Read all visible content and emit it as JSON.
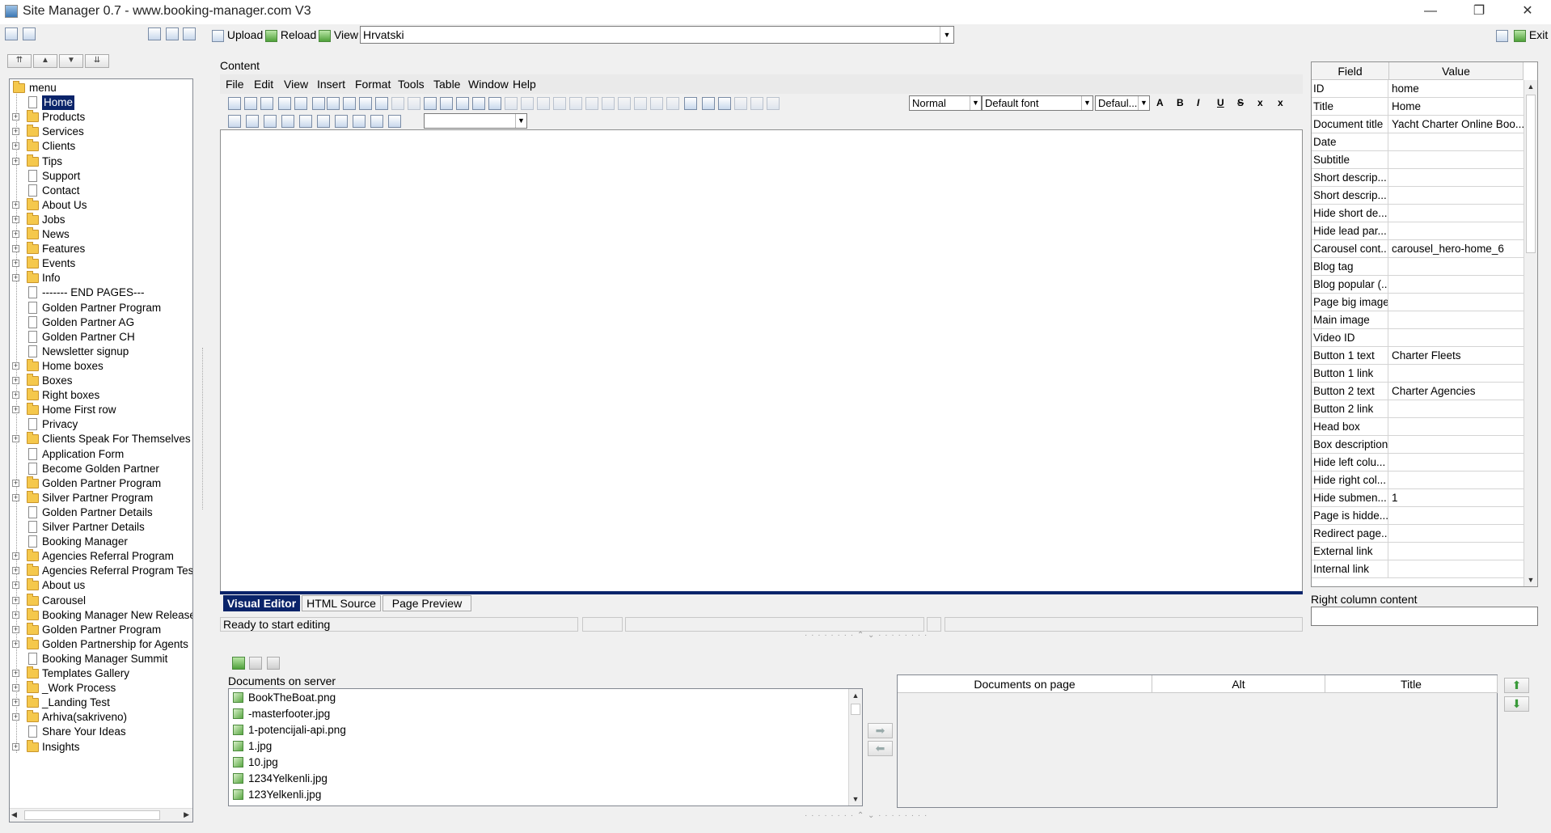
{
  "window": {
    "title": "Site Manager 0.7 - www.booking-manager.com V3",
    "controls": [
      "—",
      "❐",
      "✕"
    ]
  },
  "toolbar": {
    "upload_label": "Upload",
    "reload_label": "Reload",
    "view_label": "View",
    "view_value": "Hrvatski",
    "exit_label": "Exit"
  },
  "tree": {
    "root": "menu",
    "items": [
      {
        "label": "Home",
        "type": "page",
        "expand": false,
        "selected": true
      },
      {
        "label": "Products",
        "type": "folder",
        "expand": true
      },
      {
        "label": "Services",
        "type": "folder",
        "expand": true
      },
      {
        "label": "Clients",
        "type": "folder",
        "expand": true
      },
      {
        "label": "Tips",
        "type": "folder",
        "expand": true
      },
      {
        "label": "Support",
        "type": "page",
        "expand": false
      },
      {
        "label": "Contact",
        "type": "page",
        "expand": false
      },
      {
        "label": "About Us",
        "type": "folder",
        "expand": true
      },
      {
        "label": "Jobs",
        "type": "folder",
        "expand": true
      },
      {
        "label": "News",
        "type": "folder",
        "expand": true
      },
      {
        "label": "Features",
        "type": "folder",
        "expand": true
      },
      {
        "label": "Events",
        "type": "folder",
        "expand": true
      },
      {
        "label": "Info",
        "type": "folder",
        "expand": true
      },
      {
        "label": "------- END PAGES---",
        "type": "page",
        "expand": false
      },
      {
        "label": "Golden Partner Program",
        "type": "page",
        "expand": false
      },
      {
        "label": "Golden Partner AG",
        "type": "page",
        "expand": false
      },
      {
        "label": "Golden Partner CH",
        "type": "page",
        "expand": false
      },
      {
        "label": "Newsletter signup",
        "type": "page",
        "expand": false
      },
      {
        "label": "Home boxes",
        "type": "folder",
        "expand": true
      },
      {
        "label": "Boxes",
        "type": "folder",
        "expand": true
      },
      {
        "label": "Right boxes",
        "type": "folder",
        "expand": true
      },
      {
        "label": "Home First row",
        "type": "folder",
        "expand": true
      },
      {
        "label": "Privacy",
        "type": "page",
        "expand": false
      },
      {
        "label": "Clients Speak For Themselves",
        "type": "folder",
        "expand": true
      },
      {
        "label": "Application Form",
        "type": "page",
        "expand": false
      },
      {
        "label": "Become Golden Partner",
        "type": "page",
        "expand": false
      },
      {
        "label": "Golden Partner Program",
        "type": "folder",
        "expand": true
      },
      {
        "label": "Silver Partner Program",
        "type": "folder",
        "expand": true
      },
      {
        "label": "Golden Partner Details",
        "type": "page",
        "expand": false
      },
      {
        "label": "Silver Partner Details",
        "type": "page",
        "expand": false
      },
      {
        "label": "Booking Manager",
        "type": "page",
        "expand": false
      },
      {
        "label": "Agencies Referral Program",
        "type": "folder",
        "expand": true
      },
      {
        "label": "Agencies Referral Program Testi",
        "type": "folder",
        "expand": true
      },
      {
        "label": "About us",
        "type": "folder",
        "expand": true
      },
      {
        "label": "Carousel",
        "type": "folder",
        "expand": true
      },
      {
        "label": "Booking Manager New Releases",
        "type": "folder",
        "expand": true
      },
      {
        "label": "Golden Partner Program",
        "type": "folder",
        "expand": true
      },
      {
        "label": "Golden Partnership for Agents",
        "type": "folder",
        "expand": true
      },
      {
        "label": "Booking Manager Summit",
        "type": "page",
        "expand": false
      },
      {
        "label": "Templates Gallery",
        "type": "folder",
        "expand": true
      },
      {
        "label": "_Work Process",
        "type": "folder",
        "expand": true
      },
      {
        "label": "_Landing Test",
        "type": "folder",
        "expand": true
      },
      {
        "label": "Arhiva(sakriveno)",
        "type": "folder",
        "expand": true
      },
      {
        "label": "Share Your Ideas",
        "type": "page",
        "expand": false
      },
      {
        "label": "Insights",
        "type": "folder",
        "expand": true
      }
    ]
  },
  "editor": {
    "section_label": "Content",
    "menu": [
      "File",
      "Edit",
      "View",
      "Insert",
      "Format",
      "Tools",
      "Table",
      "Window",
      "Help"
    ],
    "format_value": "Normal",
    "font_value": "Default font",
    "size_value": "Defaul...",
    "tabs": [
      "Visual Editor",
      "HTML Source",
      "Page Preview"
    ],
    "active_tab": "Visual Editor",
    "status": "Ready to start editing"
  },
  "properties": {
    "headers": [
      "Field",
      "Value"
    ],
    "rows": [
      {
        "field": "ID",
        "value": "home"
      },
      {
        "field": "Title",
        "value": "Home"
      },
      {
        "field": "Document title",
        "value": "Yacht Charter Online Boo..."
      },
      {
        "field": "Date",
        "value": ""
      },
      {
        "field": "Subtitle",
        "value": ""
      },
      {
        "field": "Short descrip...",
        "value": ""
      },
      {
        "field": "Short descrip...",
        "value": ""
      },
      {
        "field": "Hide short de...",
        "value": ""
      },
      {
        "field": "Hide lead par...",
        "value": ""
      },
      {
        "field": "Carousel cont...",
        "value": "carousel_hero-home_6"
      },
      {
        "field": "Blog tag",
        "value": ""
      },
      {
        "field": "Blog popular (...",
        "value": ""
      },
      {
        "field": "Page big image",
        "value": ""
      },
      {
        "field": "Main image",
        "value": ""
      },
      {
        "field": "Video ID",
        "value": ""
      },
      {
        "field": "Button 1 text",
        "value": "Charter Fleets"
      },
      {
        "field": "Button 1 link",
        "value": ""
      },
      {
        "field": "Button 2 text",
        "value": "Charter Agencies"
      },
      {
        "field": "Button 2 link",
        "value": ""
      },
      {
        "field": "Head box",
        "value": ""
      },
      {
        "field": "Box description",
        "value": ""
      },
      {
        "field": "Hide left colu...",
        "value": ""
      },
      {
        "field": "Hide right col...",
        "value": ""
      },
      {
        "field": "Hide submen...",
        "value": "1"
      },
      {
        "field": "Page is hidde...",
        "value": ""
      },
      {
        "field": "Redirect page...",
        "value": ""
      },
      {
        "field": "External link",
        "value": ""
      },
      {
        "field": "Internal link",
        "value": ""
      }
    ],
    "right_column_label": "Right column content",
    "right_column_value": ""
  },
  "documents": {
    "server_label": "Documents on server",
    "server_files": [
      "BookTheBoat.png",
      "-masterfooter.jpg",
      "1-potencijali-api.png",
      "1.jpg",
      "10.jpg",
      "1234Yelkenli.jpg",
      "123Yelkenli.jpg"
    ],
    "page_headers": [
      "Documents on page",
      "Alt",
      "Title"
    ],
    "add_arrow": "➡",
    "remove_arrow": "⬅",
    "up_arrow": "⬆",
    "down_arrow": "⬇"
  },
  "colors": {
    "selection": "#0a246a",
    "window_bg": "#f0f0f0",
    "active_tab": "#0a246a"
  }
}
